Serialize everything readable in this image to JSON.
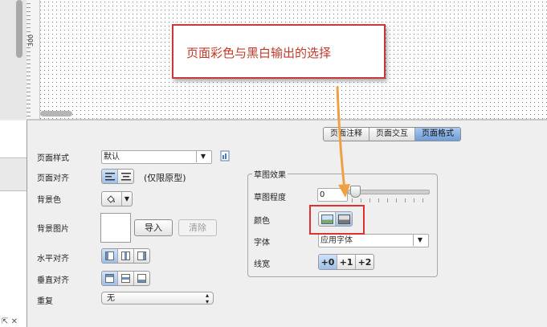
{
  "canvas": {
    "ruler_label": "300"
  },
  "tabs": [
    {
      "label": "页面注释",
      "active": false
    },
    {
      "label": "页面交互",
      "active": false
    },
    {
      "label": "页面格式",
      "active": true
    }
  ],
  "form": {
    "page_style_label": "页面样式",
    "page_style_value": "默认",
    "page_align_label": "页面对齐",
    "page_align_note": "(仅限原型)",
    "bg_color_label": "背景色",
    "bg_image_label": "背景图片",
    "import_button": "导入",
    "clear_button": "清除",
    "h_align_label": "水平对齐",
    "v_align_label": "垂直对齐",
    "repeat_label": "重复",
    "repeat_value": "无"
  },
  "sketch": {
    "group_title": "草图效果",
    "degree_label": "草图程度",
    "degree_value": "0",
    "color_label": "颜色",
    "font_label": "字体",
    "font_value": "应用字体",
    "line_width_label": "线宽",
    "line_width_options": [
      "+0",
      "+1",
      "+2"
    ],
    "line_width_selected": "+0"
  },
  "annotation": {
    "callout_text": "页面彩色与黑白输出的选择",
    "callout_color": "#c0392b",
    "highlight_color": "#e0302f",
    "arrow_color": "#f0a040"
  },
  "icons": {
    "style_manage": "style-manage-icon",
    "color_mode_color": "color-image-icon",
    "color_mode_bw": "grayscale-image-icon",
    "paint_bucket": "paint-bucket-icon"
  }
}
